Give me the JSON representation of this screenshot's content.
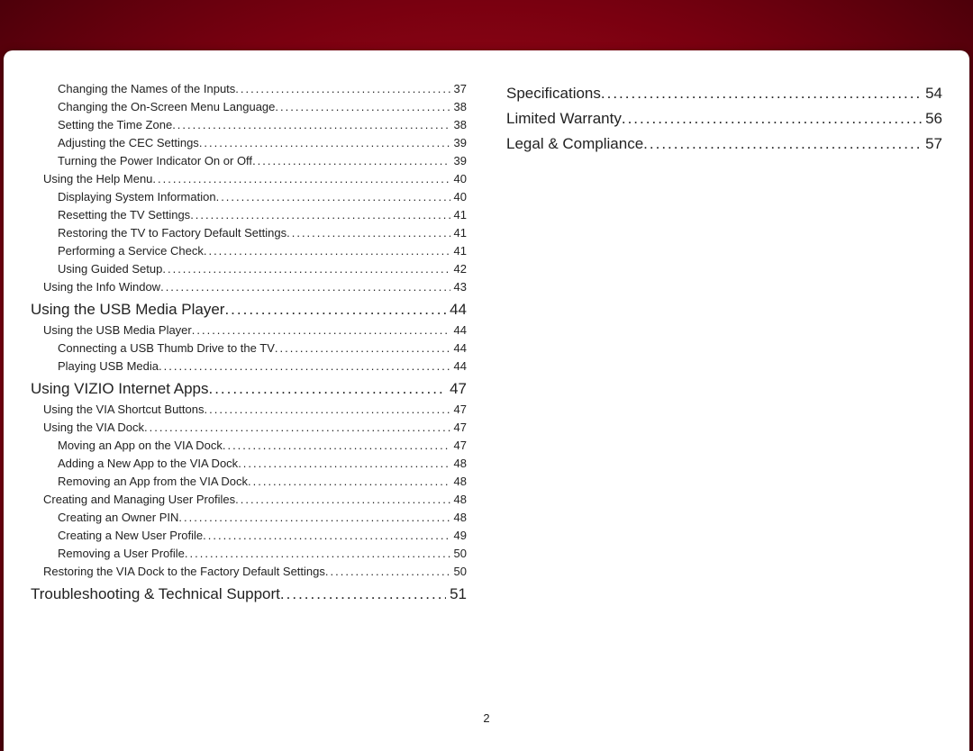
{
  "page_number": "2",
  "columns": [
    [
      {
        "level": 2,
        "text": "Changing the Names of the Inputs",
        "page": "37"
      },
      {
        "level": 2,
        "text": "Changing the On-Screen Menu Language",
        "page": "38"
      },
      {
        "level": 2,
        "text": "Setting the Time Zone",
        "page": "38"
      },
      {
        "level": 2,
        "text": "Adjusting the CEC Settings",
        "page": "39"
      },
      {
        "level": 2,
        "text": "Turning the Power Indicator On or Off",
        "page": "39"
      },
      {
        "level": 1,
        "text": "Using the Help Menu",
        "page": "40"
      },
      {
        "level": 2,
        "text": "Displaying System Information",
        "page": "40"
      },
      {
        "level": 2,
        "text": "Resetting the TV Settings",
        "page": "41"
      },
      {
        "level": 2,
        "text": "Restoring the TV to Factory Default Settings",
        "page": "41"
      },
      {
        "level": 2,
        "text": "Performing a Service Check",
        "page": "41"
      },
      {
        "level": 2,
        "text": "Using Guided Setup",
        "page": "42"
      },
      {
        "level": 1,
        "text": "Using the Info Window",
        "page": "43"
      },
      {
        "level": 0,
        "text": "Using the USB Media Player",
        "page": "44"
      },
      {
        "level": 1,
        "text": "Using the USB Media Player",
        "page": "44"
      },
      {
        "level": 2,
        "text": "Connecting a USB Thumb Drive to the TV",
        "page": "44"
      },
      {
        "level": 2,
        "text": "Playing USB Media",
        "page": "44"
      },
      {
        "level": 0,
        "text": "Using VIZIO Internet Apps",
        "page": "47"
      },
      {
        "level": 1,
        "text": "Using the VIA Shortcut Buttons",
        "page": "47"
      },
      {
        "level": 1,
        "text": "Using the VIA Dock",
        "page": "47"
      },
      {
        "level": 2,
        "text": "Moving an App on the VIA Dock",
        "page": "47"
      },
      {
        "level": 2,
        "text": "Adding a New App to the VIA Dock",
        "page": "48"
      },
      {
        "level": 2,
        "text": "Removing an App from the VIA Dock",
        "page": "48"
      },
      {
        "level": 1,
        "text": "Creating and Managing User Profiles",
        "page": "48"
      },
      {
        "level": 2,
        "text": "Creating an Owner PIN",
        "page": "48"
      },
      {
        "level": 2,
        "text": "Creating a New User Profile",
        "page": "49"
      },
      {
        "level": 2,
        "text": "Removing a User Profile",
        "page": "50"
      },
      {
        "level": 1,
        "text": "Restoring the VIA Dock to the Factory Default Settings",
        "page": "50"
      },
      {
        "level": 0,
        "text": "Troubleshooting & Technical Support",
        "page": "51"
      }
    ],
    [
      {
        "level": 0,
        "text": "Specifications",
        "page": "54"
      },
      {
        "level": 0,
        "text": "Limited Warranty",
        "page": "56"
      },
      {
        "level": 0,
        "text": "Legal & Compliance",
        "page": "57"
      }
    ]
  ]
}
